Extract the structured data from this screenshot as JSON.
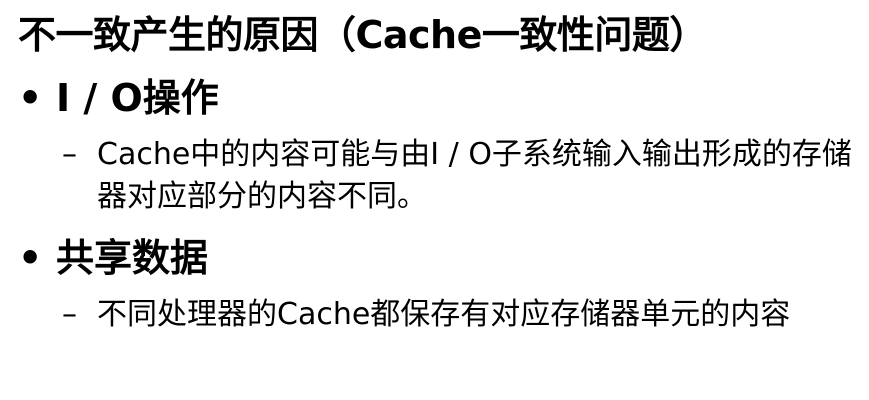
{
  "slide": {
    "title": "不一致产生的原因（Cache一致性问题）",
    "bullets": [
      {
        "marker": "•",
        "label": "I / O操作",
        "sub_marker": "–",
        "sub_text": "Cache中的内容可能与由I / O子系统输入输出形成的存储器对应部分的内容不同。"
      },
      {
        "marker": "•",
        "label": "共享数据",
        "sub_marker": "–",
        "sub_text": "不同处理器的Cache都保存有对应存储器单元的内容"
      }
    ]
  }
}
